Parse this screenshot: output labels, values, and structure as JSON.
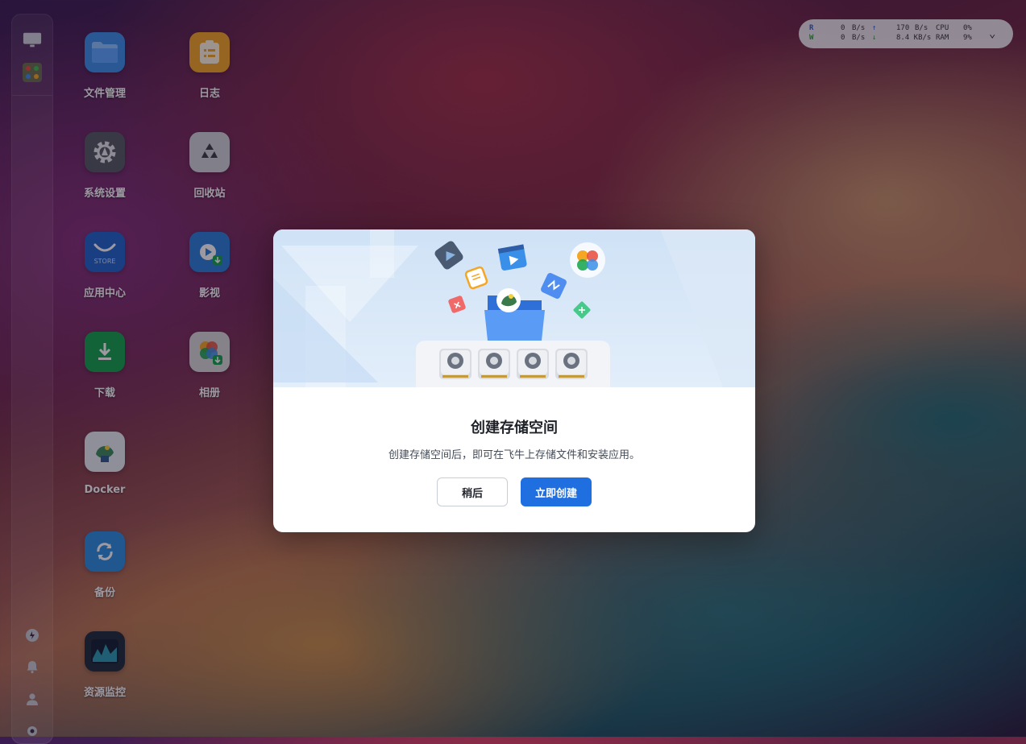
{
  "desktop": {
    "icons": [
      {
        "label": "文件管理",
        "icon": "folder-icon",
        "color": "#3a8fe8"
      },
      {
        "label": "日志",
        "icon": "log-icon",
        "color": "#f5a623"
      },
      {
        "label": "系统设置",
        "icon": "gear-icon",
        "color": "#555b63"
      },
      {
        "label": "回收站",
        "icon": "recycle-icon",
        "color": "#d0d3d8"
      },
      {
        "label": "应用中心",
        "icon": "store-icon",
        "color": "#1e62c8"
      },
      {
        "label": "影视",
        "icon": "video-icon",
        "color": "#2a7fd8"
      },
      {
        "label": "下载",
        "icon": "download-icon",
        "color": "#13a34a"
      },
      {
        "label": "相册",
        "icon": "photos-icon",
        "color": "#d8d8d8"
      },
      {
        "label": "Docker",
        "icon": "docker-icon",
        "color": "#e8eef2"
      },
      {
        "label": "备份",
        "icon": "backup-icon",
        "color": "#2c8de0"
      },
      {
        "label": "资源监控",
        "icon": "monitor-icon",
        "color": "#1d2b3a"
      }
    ],
    "store_badge": "STORE"
  },
  "monitor": {
    "read_label": "R",
    "write_label": "W",
    "read_value": "0",
    "write_value": "0",
    "read_unit": "B/s",
    "write_unit": "B/s",
    "upload_value": "170",
    "upload_unit": "B/s",
    "download_value": "8.4 KB/s",
    "cpu_label": "CPU",
    "cpu_value": "0%",
    "ram_label": "RAM",
    "ram_value": "9%"
  },
  "dialog": {
    "title": "创建存储空间",
    "description": "创建存储空间后，即可在飞牛上存储文件和安装应用。",
    "later_button": "稍后",
    "create_button": "立即创建"
  },
  "colors": {
    "primary": "#1f6fe0",
    "banner": "#d6e6f7"
  }
}
